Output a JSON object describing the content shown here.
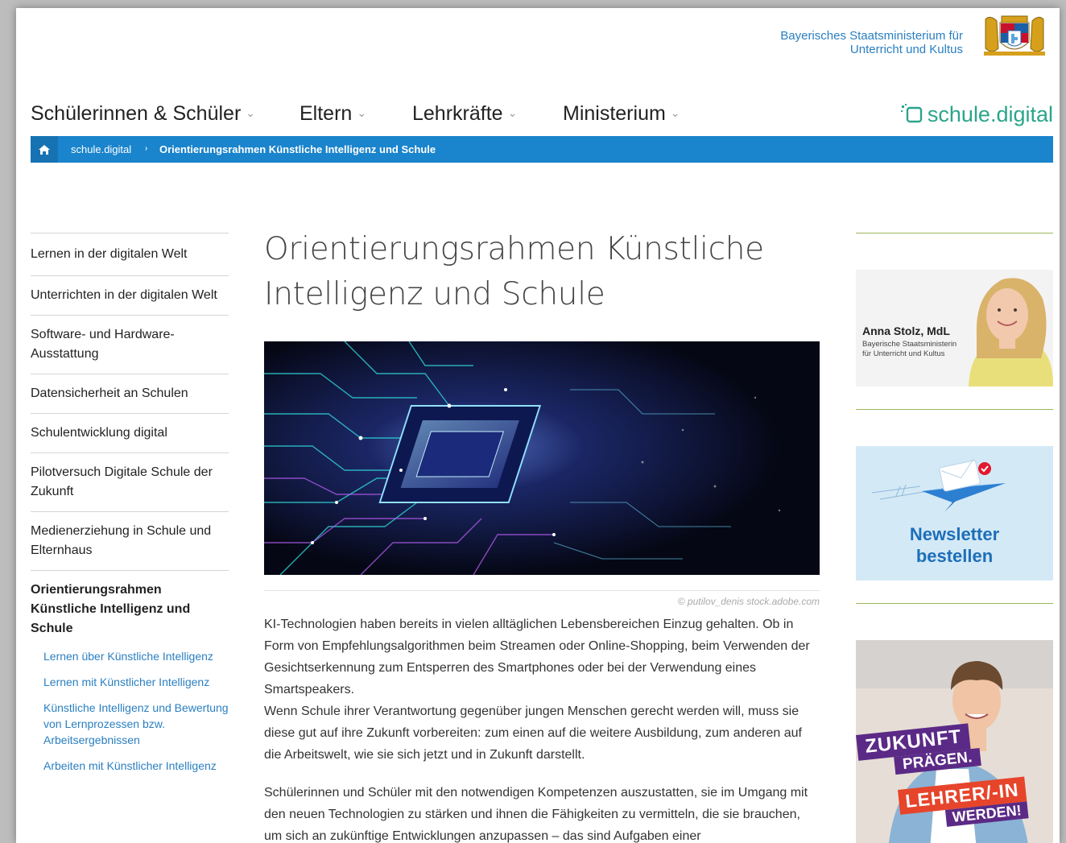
{
  "header": {
    "ministry_line1": "Bayerisches Staatsministerium für",
    "ministry_line2": "Unterricht und Kultus",
    "brand": "schule.digital"
  },
  "nav": {
    "items": [
      {
        "label": "Schülerinnen & Schüler"
      },
      {
        "label": "Eltern"
      },
      {
        "label": "Lehrkräfte"
      },
      {
        "label": "Ministerium"
      }
    ]
  },
  "breadcrumb": {
    "item1": "schule.digital",
    "item2": "Orientierungsrahmen Künstliche Intelligenz und Schule"
  },
  "sidebar": {
    "items": [
      {
        "label": "Lernen in der digitalen Welt"
      },
      {
        "label": "Unterrichten in der digitalen Welt"
      },
      {
        "label": "Software- und Hardware-Ausstattung"
      },
      {
        "label": "Datensicherheit an Schulen"
      },
      {
        "label": "Schulentwicklung digital"
      },
      {
        "label": "Pilotversuch Digitale Schule der Zukunft"
      },
      {
        "label": "Medienerziehung in Schule und Elternhaus"
      },
      {
        "label": "Orientierungsrahmen Künstliche Intelligenz und Schule"
      }
    ],
    "sub_items": [
      {
        "label": "Lernen über Künstliche Intelligenz"
      },
      {
        "label": "Lernen mit Künstlicher Intelligenz"
      },
      {
        "label": "Künstliche Intelligenz und Bewertung von Lernprozessen bzw. Arbeitsergebnissen"
      },
      {
        "label": "Arbeiten mit Künstlicher Intelligenz"
      }
    ]
  },
  "article": {
    "title": "Orientierungsrahmen Künstliche Intelligenz und Schule",
    "image_credit": "© putilov_denis stock.adobe.com",
    "paragraph1": "KI-Technologien haben bereits in vielen alltäglichen Lebensbereichen Einzug gehalten. Ob in Form von Empfehlungsalgorithmen beim Streamen oder Online-Shopping, beim Verwenden der Gesichtserkennung zum Entsperren des Smartphones oder bei der Verwendung eines Smartspeakers.",
    "paragraph1b": "Wenn Schule ihrer Verantwortung gegenüber jungen Menschen gerecht werden will, muss sie diese gut auf ihre Zukunft vorbereiten: zum einen auf die weitere Ausbildung, zum anderen auf die Arbeitswelt, wie sie sich jetzt und in Zukunft darstellt.",
    "paragraph2": "Schülerinnen und Schüler mit den notwendigen Kompetenzen auszustatten, sie im Umgang mit den neuen Technologien zu stärken und ihnen die Fähigkeiten zu vermitteln, die sie brauchen, um sich an zukünftige Entwicklungen anzupassen – das sind Aufgaben einer"
  },
  "right": {
    "minister_name": "Anna Stolz, MdL",
    "minister_role1": "Bayerische Staatsministerin",
    "minister_role2": "für Unterricht und Kultus",
    "newsletter_line1": "Newsletter",
    "newsletter_line2": "bestellen",
    "teacher_line1": "ZUKUNFT",
    "teacher_line2": "PRÄGEN.",
    "teacher_line3": "LEHRER/-IN",
    "teacher_line4": "WERDEN!"
  },
  "colors": {
    "accent_blue": "#1a84cc",
    "link_blue": "#2a7fc1",
    "brand_green": "#2ba58b",
    "divider_green": "#9ab75a"
  }
}
